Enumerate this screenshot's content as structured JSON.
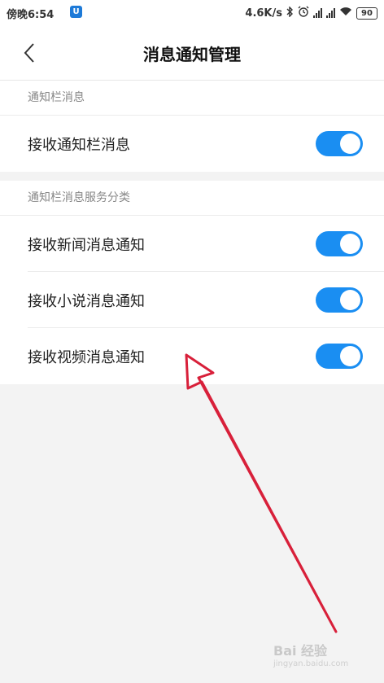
{
  "status_bar": {
    "time": "傍晚6:54",
    "app_icon_glyph": "U",
    "net_speed": "4.6K/s",
    "battery": "90"
  },
  "header": {
    "title": "消息通知管理",
    "back_icon": "chevron-left-icon"
  },
  "sections": [
    {
      "header": "通知栏消息",
      "rows": [
        {
          "label": "接收通知栏消息",
          "enabled": true
        }
      ]
    },
    {
      "header": "通知栏消息服务分类",
      "rows": [
        {
          "label": "接收新闻消息通知",
          "enabled": true
        },
        {
          "label": "接收小说消息通知",
          "enabled": true
        },
        {
          "label": "接收视频消息通知",
          "enabled": true
        }
      ]
    }
  ],
  "colors": {
    "toggle_on": "#1a8ef2",
    "annotation": "#d8203a"
  },
  "watermark": {
    "text": "Bai 经验",
    "subtext": "jingyan.baidu.com"
  }
}
